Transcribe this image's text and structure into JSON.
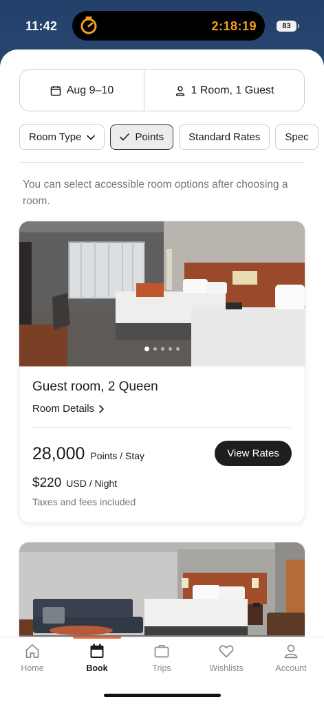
{
  "status_bar": {
    "time": "11:42",
    "timer": "2:18:19",
    "battery": "83"
  },
  "search": {
    "dates": "Aug 9–10",
    "occupancy": "1 Room, 1 Guest"
  },
  "filters": [
    {
      "label": "Room Type",
      "icon": "chevron-down-icon",
      "active": false
    },
    {
      "label": "Points",
      "icon": "checkmark-icon",
      "active": true
    },
    {
      "label": "Standard Rates",
      "active": false
    },
    {
      "label": "Spec",
      "active": false
    }
  ],
  "notice": "You can select accessible room options after choosing a room.",
  "rooms": [
    {
      "name": "Guest room, 2 Queen",
      "details_link": "Room Details",
      "photo_count": 5,
      "photo_index": 1,
      "points": "28,000",
      "points_unit": "Points / Stay",
      "price": "$220",
      "price_unit": "USD / Night",
      "taxes_note": "Taxes and fees included",
      "cta": "View Rates"
    }
  ],
  "tabbar": {
    "items": [
      {
        "label": "Home",
        "icon": "home-icon"
      },
      {
        "label": "Book",
        "icon": "calendar-icon"
      },
      {
        "label": "Trips",
        "icon": "briefcase-icon"
      },
      {
        "label": "Wishlists",
        "icon": "heart-icon"
      },
      {
        "label": "Account",
        "icon": "person-icon"
      }
    ],
    "active": "Book"
  },
  "colors": {
    "accent": "#f26b3a",
    "timer": "#f4a01f",
    "button": "#1e1e1e"
  }
}
